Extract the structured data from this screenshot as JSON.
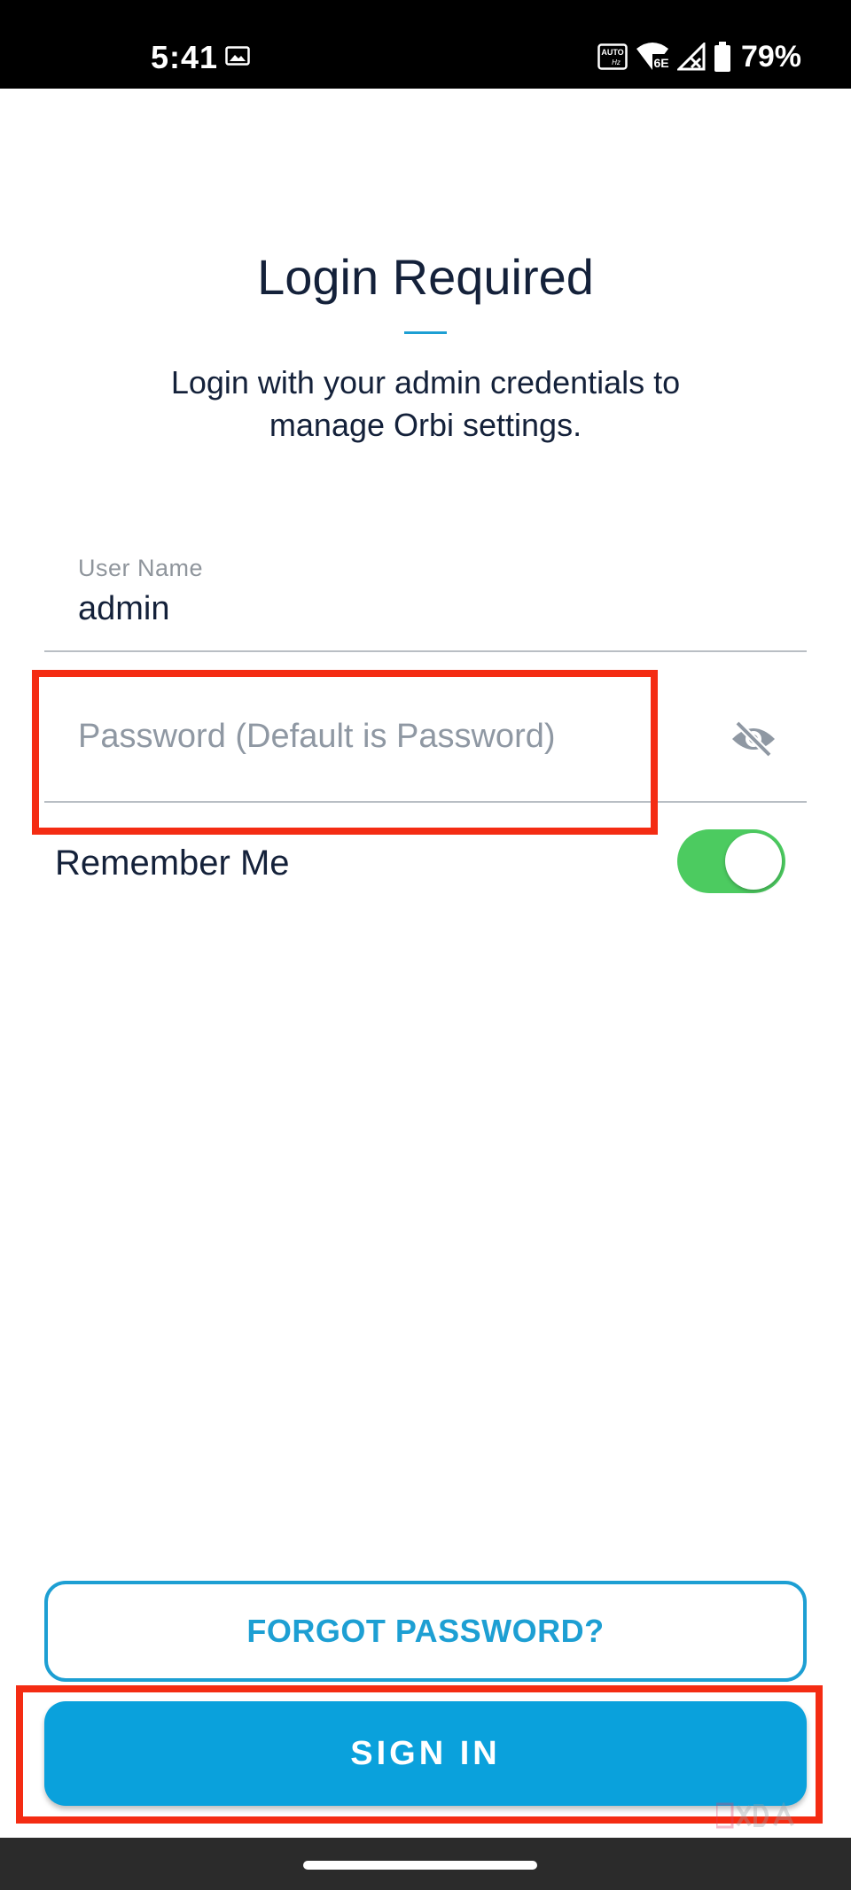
{
  "status_bar": {
    "time": "5:41",
    "battery": "79%",
    "refresh_badge_top": "AUTO",
    "refresh_badge_bottom": "Hz",
    "wifi_badge": "6E",
    "icons": [
      "gallery-icon",
      "auto-refresh-icon",
      "wifi-6e-icon",
      "signal-no-service-icon",
      "battery-icon"
    ]
  },
  "header": {
    "title": "Login Required",
    "subtitle": "Login with your admin credentials to manage Orbi settings."
  },
  "form": {
    "username": {
      "label": "User Name",
      "value": "admin"
    },
    "password": {
      "placeholder": "Password (Default is Password)",
      "visibility_icon": "eye-off-icon"
    },
    "remember_me": {
      "label": "Remember Me",
      "enabled": true
    }
  },
  "actions": {
    "forgot_label": "FORGOT PASSWORD?",
    "signin_label": "SIGN IN"
  },
  "colors": {
    "accent": "#1d9fd3",
    "signin_bg": "#0aa1dc",
    "toggle_on": "#4ccb60",
    "highlight": "#f42c13",
    "text": "#14213a"
  }
}
